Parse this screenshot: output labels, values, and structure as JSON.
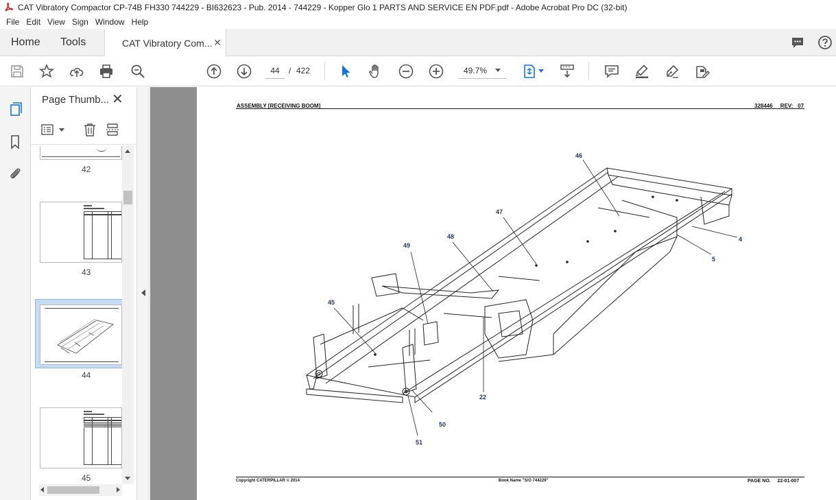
{
  "window": {
    "title": "CAT Vibratory Compactor CP-74B FH330 744229 - BI632623 - Pub. 2014 - 744229 - Kopper Glo 1 PARTS AND SERVICE EN PDF.pdf - Adobe Acrobat Pro DC (32-bit)"
  },
  "menu": [
    "File",
    "Edit",
    "View",
    "Sign",
    "Window",
    "Help"
  ],
  "tabs": {
    "home": "Home",
    "tools": "Tools",
    "document": "CAT Vibratory Com..."
  },
  "toolbar": {
    "current_page": "44",
    "page_separator": "/",
    "total_pages": "422",
    "zoom": "49.7%"
  },
  "thumbnail_panel": {
    "title": "Page Thumb...",
    "pages": [
      {
        "label": "42"
      },
      {
        "label": "43"
      },
      {
        "label": "44",
        "selected": true
      },
      {
        "label": "45"
      }
    ]
  },
  "document_page": {
    "header_left": "ASSEMBLY [RECEIVING BOOM]",
    "header_right": "328446     REV:   07",
    "footer_left": "Copyright CATERPILLAR © 2014",
    "footer_center": "Book Name \"S/O 744229\"",
    "footer_right": "PAGE NO.     22-01-007",
    "callouts": [
      "46",
      "47",
      "4",
      "5",
      "48",
      "49",
      "45",
      "22",
      "50",
      "51"
    ]
  },
  "colors": {
    "accent": "#1473e6",
    "callout": "#1a3a66",
    "pdf_red": "#d7262b",
    "canvas_gray": "#8e8e8e"
  }
}
